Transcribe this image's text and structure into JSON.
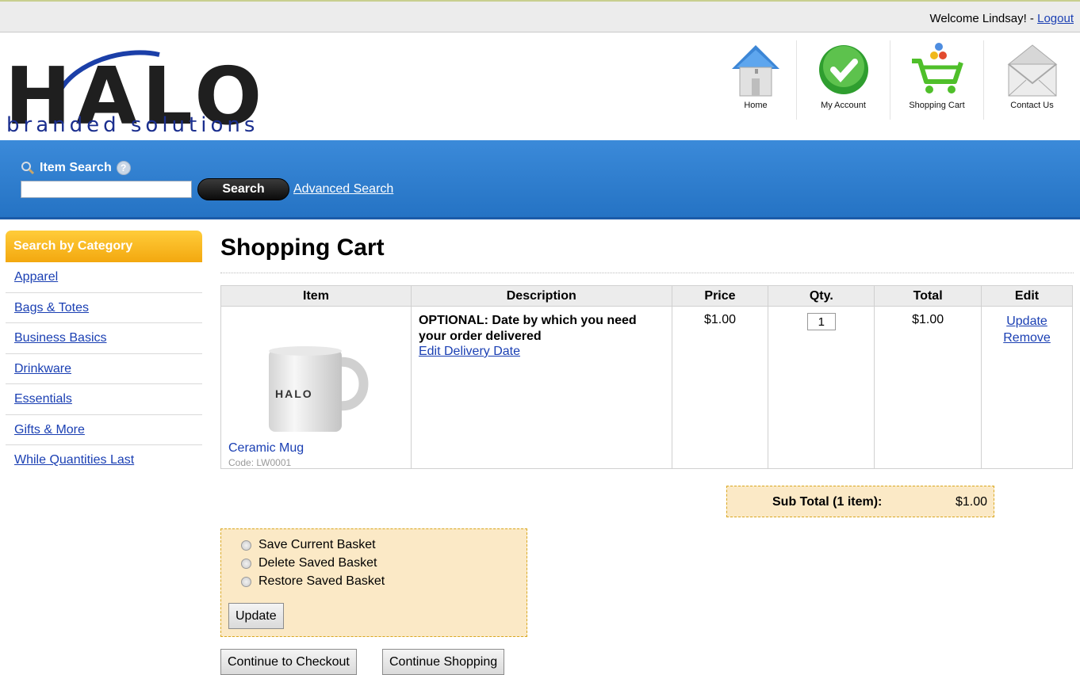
{
  "topbar": {
    "welcome": "Welcome Lindsay! -",
    "logout": "Logout"
  },
  "logo": {
    "word": "HALO",
    "sub": "branded solutions"
  },
  "nav": [
    {
      "label": "Home",
      "icon": "home-icon"
    },
    {
      "label": "My Account",
      "icon": "checkmark-icon"
    },
    {
      "label": "Shopping Cart",
      "icon": "shopping-cart-icon"
    },
    {
      "label": "Contact Us",
      "icon": "envelope-icon"
    }
  ],
  "search": {
    "title": "Item Search",
    "button": "Search",
    "advanced": "Advanced Search",
    "value": ""
  },
  "sidebar": {
    "heading": "Search by Category",
    "items": [
      "Apparel",
      "Bags & Totes",
      "Business Basics",
      "Drinkware",
      "Essentials",
      "Gifts & More",
      "While Quantities Last"
    ]
  },
  "main": {
    "title": "Shopping Cart",
    "columns": [
      "Item",
      "Description",
      "Price",
      "Qty.",
      "Total",
      "Edit"
    ],
    "row": {
      "name": "Ceramic Mug",
      "code": "Code: LW0001",
      "mug_logo": "HALO",
      "description": "OPTIONAL: Date by which you need your order delivered",
      "edit_date": "Edit Delivery Date",
      "price": "$1.00",
      "qty": "1",
      "total": "$1.00",
      "update": "Update",
      "remove": "Remove"
    },
    "subtotal_label": "Sub Total (1 item):",
    "subtotal_value": "$1.00",
    "basket_options": [
      "Save Current Basket",
      "Delete Saved Basket",
      "Restore Saved Basket"
    ],
    "basket_update": "Update",
    "checkout": "Continue to Checkout",
    "continue": "Continue Shopping"
  },
  "colors": {
    "blue_band": "#2a7ccc",
    "orange_head": "#f5ad14",
    "tan_box": "#fbe9c6",
    "link": "#1a3fb3"
  }
}
